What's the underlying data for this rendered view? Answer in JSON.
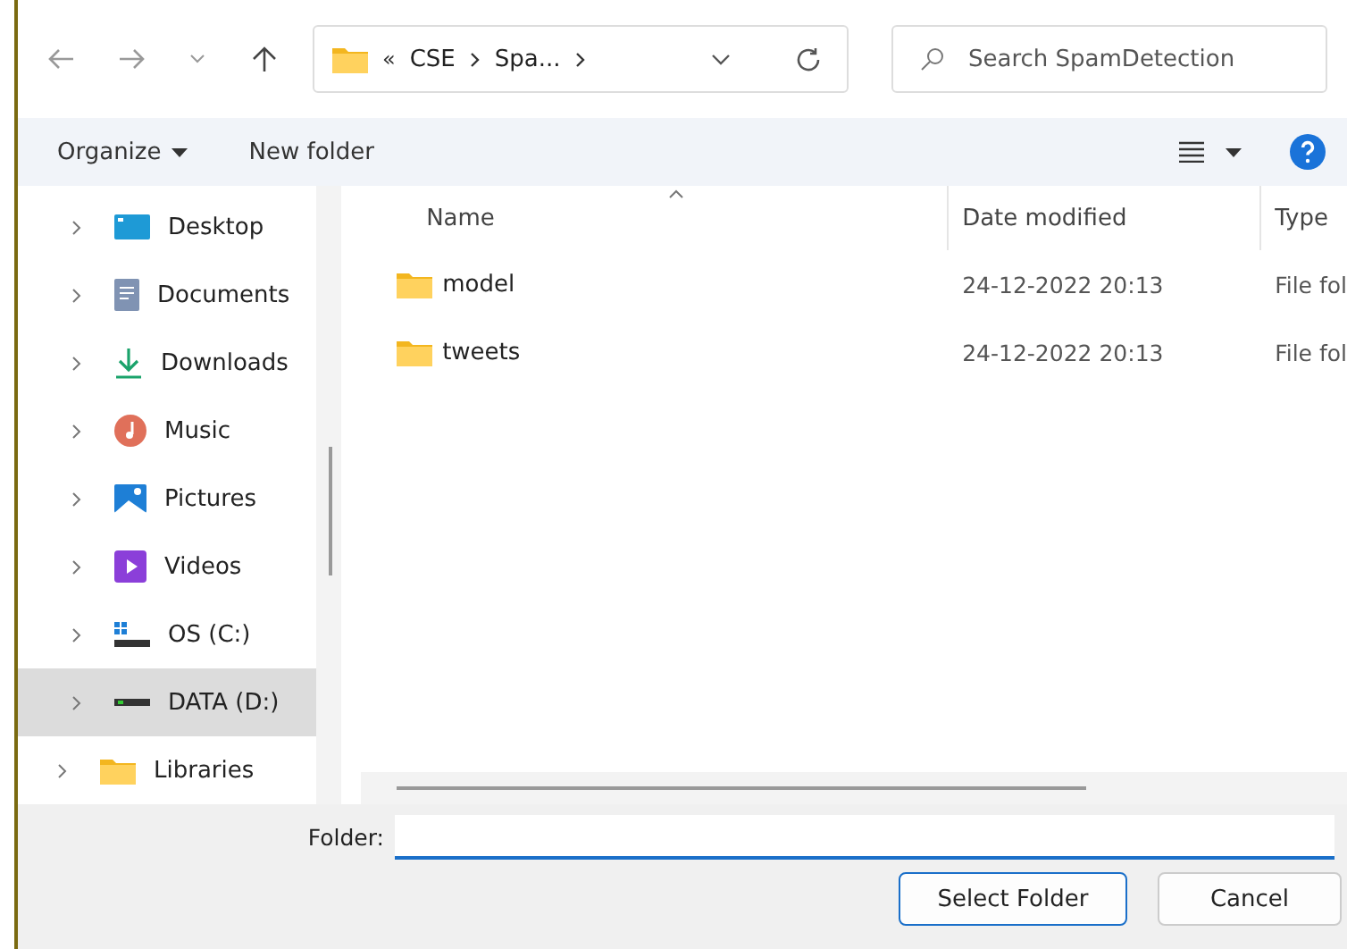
{
  "nav": {
    "path": [
      {
        "text": "«",
        "kind": "overflow"
      },
      {
        "text": "CSE",
        "kind": "crumb"
      },
      {
        "text": "Spa...",
        "kind": "crumb"
      }
    ],
    "search": {
      "placeholder": "Search SpamDetection"
    }
  },
  "toolbar": {
    "organize": "Organize",
    "new_folder": "New folder"
  },
  "sidebar": {
    "tree": [
      {
        "children": [
          {
            "label": "Desktop",
            "kind": "desktop",
            "selected": false
          },
          {
            "label": "Documents",
            "kind": "documents",
            "selected": false
          },
          {
            "label": "Downloads",
            "kind": "downloads",
            "selected": false
          },
          {
            "label": "Music",
            "kind": "music",
            "selected": false
          },
          {
            "label": "Pictures",
            "kind": "pictures",
            "selected": false
          },
          {
            "label": "Videos",
            "kind": "videos",
            "selected": false
          },
          {
            "label": "OS (C:)",
            "kind": "osdrive",
            "selected": false
          },
          {
            "label": "DATA (D:)",
            "kind": "drive",
            "selected": true
          }
        ]
      },
      {
        "label": "Libraries",
        "kind": "folder",
        "selected": false
      }
    ]
  },
  "table": {
    "columns": [
      "Name",
      "Date modified",
      "Type"
    ],
    "rows": [
      {
        "name": "model",
        "date": "24-12-2022 20:13",
        "type": "File fol"
      },
      {
        "name": "tweets",
        "date": "24-12-2022 20:13",
        "type": "File fol"
      }
    ]
  },
  "footer": {
    "label": "Folder:",
    "buttons": [
      {
        "text": "Select Folder",
        "kind": "primary"
      },
      {
        "text": "Cancel",
        "kind": "normal"
      }
    ]
  }
}
